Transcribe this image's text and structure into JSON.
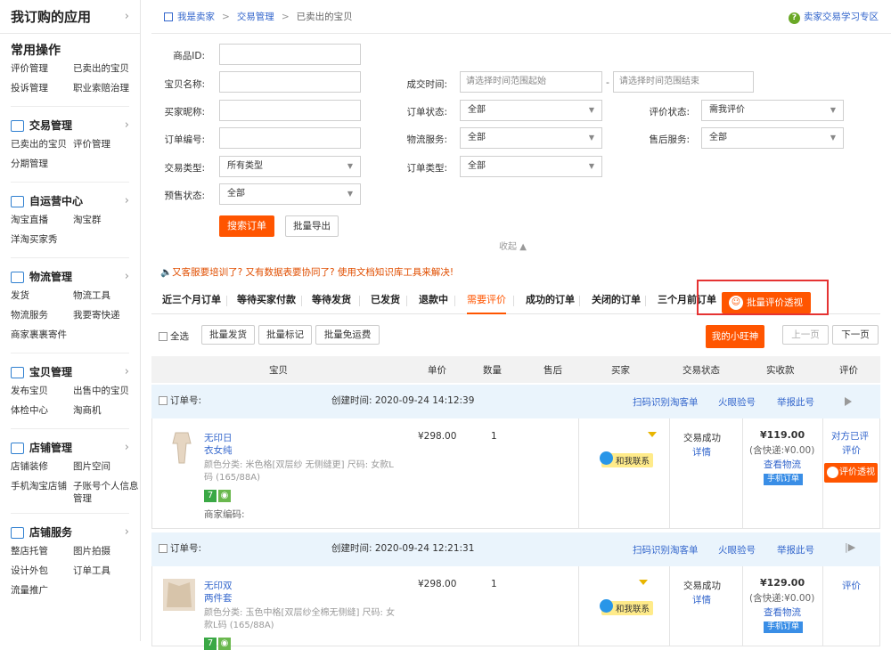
{
  "sidebar": {
    "title": "我订购的应用",
    "common_title": "常用操作",
    "common_items": [
      "评价管理",
      "已卖出的宝贝",
      "投诉管理",
      "职业索赔治理"
    ],
    "sections": [
      {
        "title": "交易管理",
        "icon": "trade-icon",
        "items": [
          "已卖出的宝贝",
          "评价管理",
          "分期管理"
        ]
      },
      {
        "title": "自运营中心",
        "icon": "message-icon",
        "items": [
          "淘宝直播",
          "淘宝群",
          "洋淘买家秀"
        ]
      },
      {
        "title": "物流管理",
        "icon": "truck-icon",
        "items": [
          "发货",
          "物流工具",
          "物流服务",
          "我要寄快递",
          "商家裹裹寄件"
        ]
      },
      {
        "title": "宝贝管理",
        "icon": "product-icon",
        "items": [
          "发布宝贝",
          "出售中的宝贝",
          "体检中心",
          "淘商机"
        ]
      },
      {
        "title": "店铺管理",
        "icon": "shop-icon",
        "items": [
          "店铺装修",
          "图片空间",
          "手机淘宝店铺",
          "子账号个人信息管理"
        ]
      },
      {
        "title": "店铺服务",
        "icon": "grid-icon",
        "items": [
          "整店托管",
          "图片拍摄",
          "设计外包",
          "订单工具",
          "流量推广"
        ]
      }
    ]
  },
  "breadcrumb": [
    "我是卖家",
    "交易管理",
    "已卖出的宝贝"
  ],
  "help_link": "卖家交易学习专区",
  "filters": {
    "item_id_label": "商品ID:",
    "item_name_label": "宝贝名称:",
    "deal_time_label": "成交时间:",
    "time_start_placeholder": "请选择时间范围起始",
    "time_end_placeholder": "请选择时间范围结束",
    "buyer_label": "买家昵称:",
    "order_status_label": "订单状态:",
    "order_status_value": "全部",
    "review_status_label": "评价状态:",
    "review_status_value": "需我评价",
    "order_no_label": "订单编号:",
    "logistics_label": "物流服务:",
    "logistics_value": "全部",
    "aftersale_label": "售后服务:",
    "aftersale_value": "全部",
    "trade_type_label": "交易类型:",
    "trade_type_value": "所有类型",
    "order_type_label": "订单类型:",
    "order_type_value": "全部",
    "presale_label": "预售状态:",
    "presale_value": "全部",
    "search_button": "搜索订单",
    "export_button": "批量导出",
    "collapse": "收起"
  },
  "notice": "又客服要培训了? 又有数据表要协同了? 使用文档知识库工具来解决!",
  "tabs": [
    "近三个月订单",
    "等待买家付款",
    "等待发货",
    "已发货",
    "退款中",
    "需要评价",
    "成功的订单",
    "关闭的订单",
    "三个月前订单"
  ],
  "active_tab": "需要评价",
  "batch_review_button": "批量评价透视",
  "toolbar": {
    "select_all": "全选",
    "batch_ship": "批量发货",
    "batch_mark": "批量标记",
    "batch_free_shipping": "批量免运费",
    "my_wangwang": "我的小旺神",
    "prev": "上一页",
    "next": "下一页"
  },
  "columns": [
    "宝贝",
    "单价",
    "数量",
    "售后",
    "买家",
    "交易状态",
    "实收款",
    "评价"
  ],
  "orders": [
    {
      "order_no_label": "订单号:",
      "created": "创建时间: 2020-09-24 14:12:39",
      "actions": [
        "扫码识别淘客单",
        "火眼验号",
        "举报此号"
      ],
      "name": "无印日",
      "name2": "衣女纯",
      "spec": "颜色分类: 米色格[双层纱 无侧缝更] 尺码: 女款L码 (165/88A)",
      "merchant_code": "商家编码:",
      "price": "¥298.00",
      "qty": "1",
      "contact": "和我联系",
      "status": "交易成功",
      "detail": "详情",
      "paid": "¥119.00",
      "shipping": "(含快递:¥0.00)",
      "view_logistics": "查看物流",
      "mobile_order": "手机订单",
      "review_text": "对方已评",
      "review_link": "评价",
      "review_button": "评价透视"
    },
    {
      "order_no_label": "订单号:",
      "created": "创建时间: 2020-09-24 12:21:31",
      "actions": [
        "扫码识别淘客单",
        "火眼验号",
        "举报此号"
      ],
      "name": "无印双",
      "name2": "两件套",
      "spec": "颜色分类: 玉色中格[双层纱全棉无侧缝] 尺码: 女款L码 (165/88A)",
      "price": "¥298.00",
      "qty": "1",
      "contact": "和我联系",
      "status": "交易成功",
      "detail": "详情",
      "paid": "¥129.00",
      "shipping": "(含快递:¥0.00)",
      "view_logistics": "查看物流",
      "mobile_order": "手机订单",
      "review_link": "评价"
    }
  ]
}
